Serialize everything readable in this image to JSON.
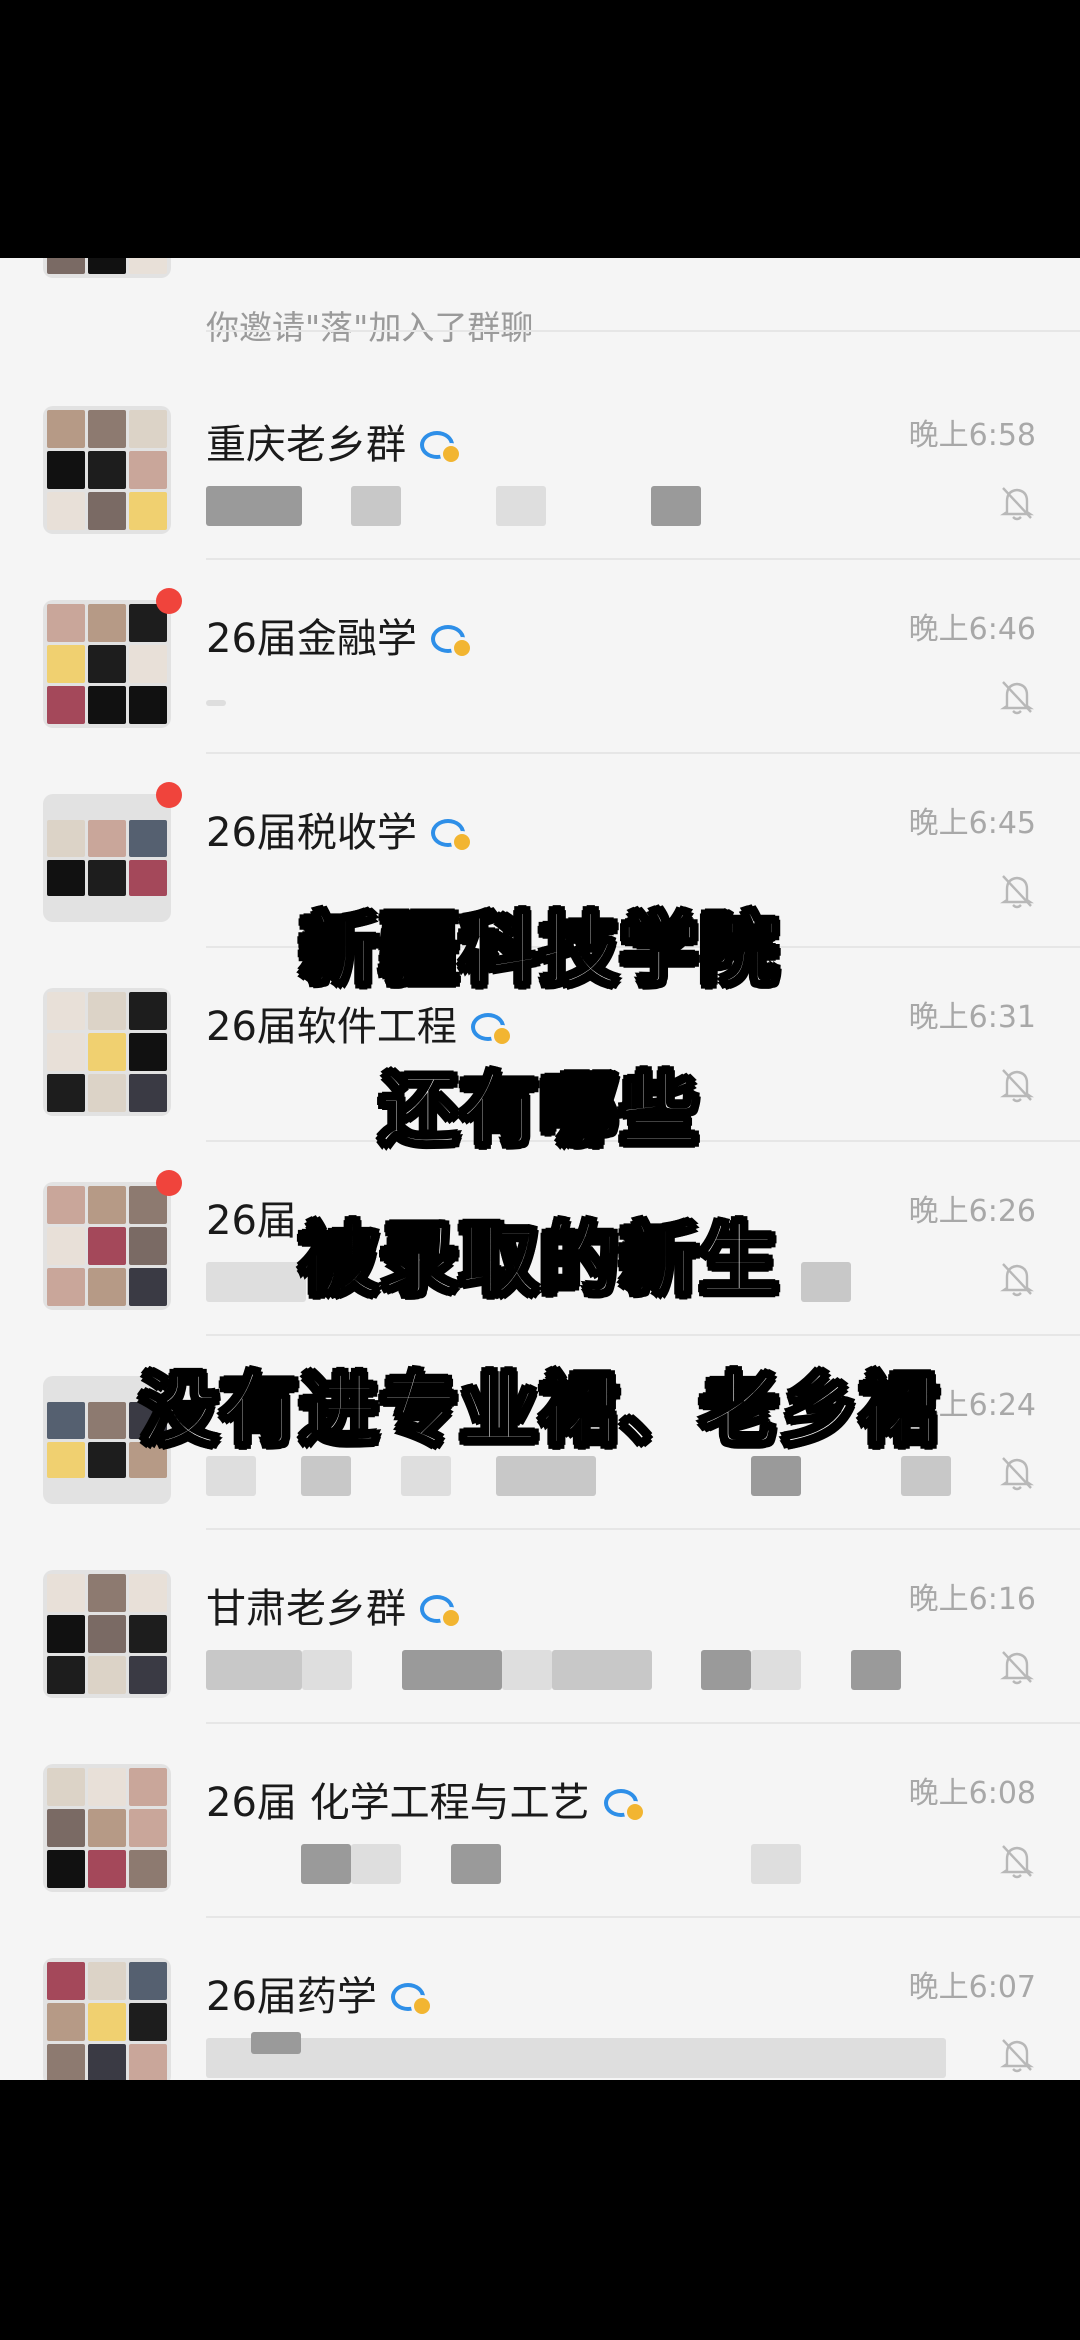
{
  "chat_list": {
    "partial_top_row": {
      "preview": "你邀请\"落\"加入了群聊"
    },
    "rows": [
      {
        "name": "重庆老乡群",
        "time": "晚上6:58",
        "unread": false,
        "muted": true
      },
      {
        "name": "26届金融学",
        "time": "晚上6:46",
        "unread": true,
        "muted": true
      },
      {
        "name": "26届税收学",
        "time": "晚上6:45",
        "unread": true,
        "muted": true
      },
      {
        "name": "26届软件工程",
        "time": "晚上6:31",
        "unread": false,
        "muted": true
      },
      {
        "name": "26届",
        "time": "晚上6:26",
        "unread": true,
        "muted": true
      },
      {
        "name": "",
        "time": "晚上6:24",
        "unread": false,
        "muted": true
      },
      {
        "name": "甘肃老乡群",
        "time": "晚上6:16",
        "unread": false,
        "muted": true
      },
      {
        "name": "26届 化学工程与工艺",
        "time": "晚上6:08",
        "unread": false,
        "muted": true
      },
      {
        "name": "26届药学",
        "time": "晚上6:07",
        "unread": false,
        "muted": true
      }
    ],
    "icons": {
      "group_badge": "group-chat-badge-icon",
      "mute": "bell-muted-icon"
    },
    "colors": {
      "unread_dot": "#f0443c",
      "badge_blue": "#2e8fe8"
    }
  },
  "overlay_caption": {
    "line1": "新疆科技学院",
    "line2": "还有哪些",
    "line3": "被录取的新生",
    "line4": "没有进专业裙、老乡裙"
  }
}
